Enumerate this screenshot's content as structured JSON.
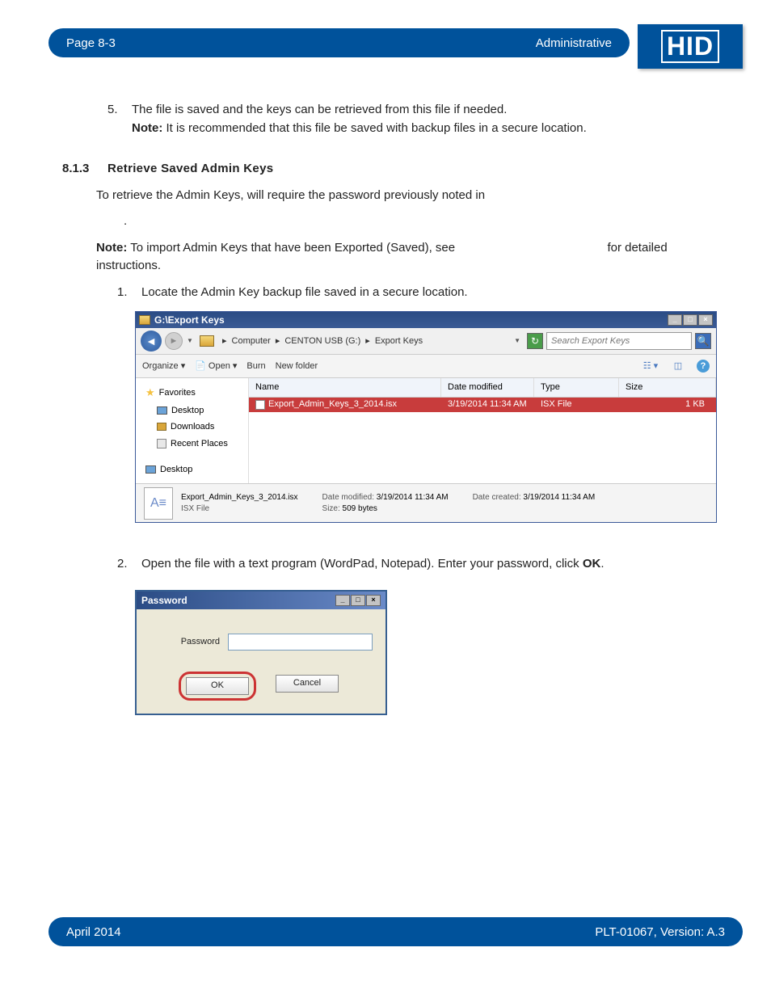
{
  "header": {
    "page": "Page 8-3",
    "section": "Administrative",
    "logo": "HID"
  },
  "step5": {
    "num": "5.",
    "line1": "The file is saved and the keys can be retrieved from this file if needed.",
    "note_label": "Note:",
    "note_text": " It is recommended that this file be saved with backup files in a secure location."
  },
  "section813": {
    "num": "8.1.3",
    "title": "Retrieve Saved Admin Keys"
  },
  "para1": "To retrieve the Admin Keys, will require the password previously noted in ",
  "note2": {
    "label": "Note:",
    "text": " To import Admin Keys that have been Exported (Saved), see ",
    "tail": " for detailed instructions."
  },
  "step1": {
    "num": "1.",
    "text": "Locate the Admin Key backup file saved in a secure location."
  },
  "step2": {
    "num": "2.",
    "text": "Open the file with a text program (WordPad, Notepad). Enter your password, click ",
    "bold": "OK",
    "period": "."
  },
  "explorer": {
    "title": "G:\\Export Keys",
    "path": {
      "p1": "Computer",
      "p2": "CENTON USB (G:)",
      "p3": "Export Keys"
    },
    "search_placeholder": "Search Export Keys",
    "toolbar": {
      "organize": "Organize",
      "open": "Open",
      "burn": "Burn",
      "newfolder": "New folder"
    },
    "nav": {
      "favorites": "Favorites",
      "desktop": "Desktop",
      "downloads": "Downloads",
      "recent": "Recent Places",
      "desktop2": "Desktop"
    },
    "columns": {
      "name": "Name",
      "date": "Date modified",
      "type": "Type",
      "size": "Size"
    },
    "row": {
      "name": "Export_Admin_Keys_3_2014.isx",
      "date": "3/19/2014 11:34 AM",
      "type": "ISX File",
      "size": "1 KB"
    },
    "status": {
      "filename": "Export_Admin_Keys_3_2014.isx",
      "filetype": "ISX File",
      "mod_label": "Date modified:",
      "mod_val": "3/19/2014 11:34 AM",
      "size_label": "Size:",
      "size_val": "509 bytes",
      "created_label": "Date created:",
      "created_val": "3/19/2014 11:34 AM"
    }
  },
  "pwd": {
    "title": "Password",
    "label": "Password",
    "ok": "OK",
    "cancel": "Cancel"
  },
  "footer": {
    "date": "April 2014",
    "doc": "PLT-01067, Version: A.3"
  }
}
